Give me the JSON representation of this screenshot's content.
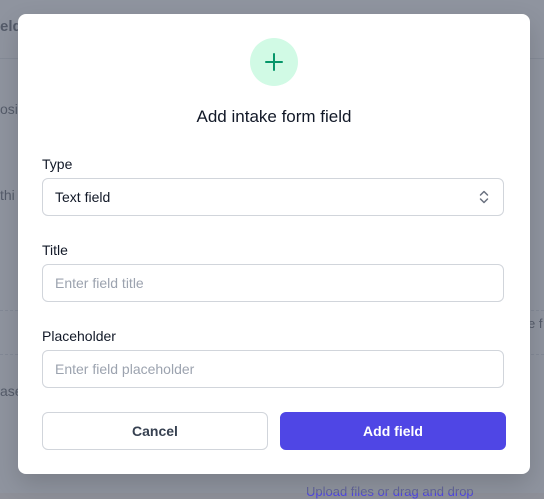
{
  "background": {
    "fragments": [
      "eld",
      "osi",
      "thi",
      "ase",
      "e f",
      "Upload files or drag and drop"
    ]
  },
  "modal": {
    "icon": "plus-icon",
    "title": "Add intake form field",
    "type": {
      "label": "Type",
      "value": "Text field"
    },
    "title_field": {
      "label": "Title",
      "placeholder": "Enter field title",
      "value": ""
    },
    "placeholder_field": {
      "label": "Placeholder",
      "placeholder": "Enter field placeholder",
      "value": ""
    },
    "cancel_label": "Cancel",
    "submit_label": "Add field"
  },
  "colors": {
    "accent": "#4f46e5",
    "icon_bg": "#d1fae5",
    "icon_fg": "#059669"
  }
}
